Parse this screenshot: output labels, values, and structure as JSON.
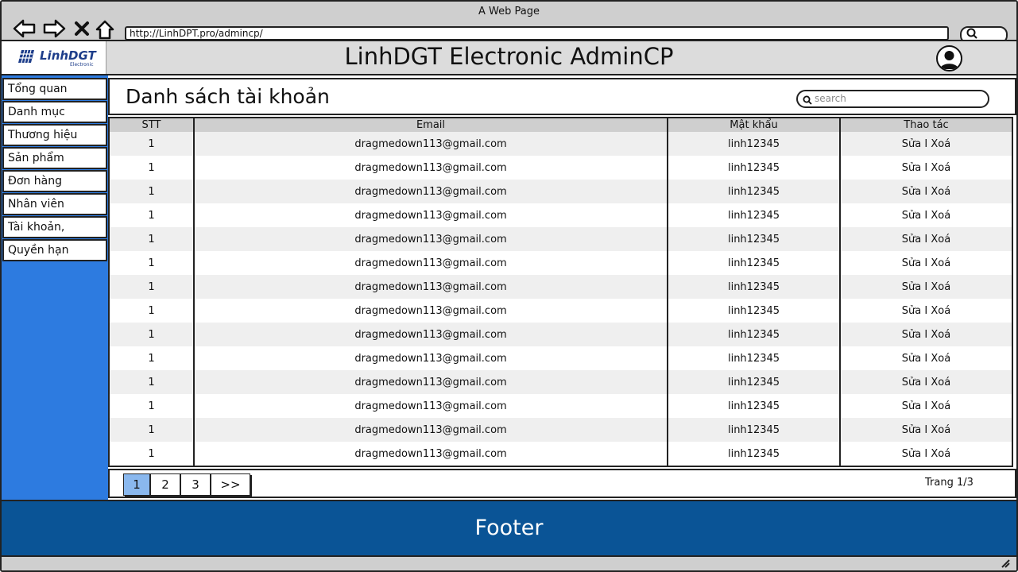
{
  "window": {
    "title": "A Web Page"
  },
  "browser": {
    "url": "http://LinhDPT.pro/admincp/",
    "back_icon": "back-arrow-icon",
    "forward_icon": "forward-arrow-icon",
    "close_icon": "close-icon",
    "home_icon": "home-icon",
    "search_icon": "search-icon"
  },
  "header": {
    "logo_text": "LinhDGT",
    "logo_sub": "Electronic",
    "title": "LinhDGT Electronic AdminCP",
    "avatar_icon": "user-avatar-icon"
  },
  "sidebar": {
    "items": [
      {
        "label": "Tổng quan"
      },
      {
        "label": "Danh mục"
      },
      {
        "label": "Thương hiệu"
      },
      {
        "label": "Sản phẩm"
      },
      {
        "label": "Đơn hàng"
      },
      {
        "label": "Nhân viên"
      },
      {
        "label": "Tài khoản,"
      },
      {
        "label": "Quyền hạn"
      }
    ]
  },
  "main": {
    "title": "Danh sách tài khoản",
    "search_placeholder": "search",
    "table": {
      "columns": [
        "STT",
        "Email",
        "Mật khẩu",
        "Thao tác"
      ],
      "rows": [
        [
          "1",
          "dragmedown113@gmail.com",
          "linh12345",
          "Sửa I Xoá"
        ],
        [
          "1",
          "dragmedown113@gmail.com",
          "linh12345",
          "Sửa I Xoá"
        ],
        [
          "1",
          "dragmedown113@gmail.com",
          "linh12345",
          "Sửa I Xoá"
        ],
        [
          "1",
          "dragmedown113@gmail.com",
          "linh12345",
          "Sửa I Xoá"
        ],
        [
          "1",
          "dragmedown113@gmail.com",
          "linh12345",
          "Sửa I Xoá"
        ],
        [
          "1",
          "dragmedown113@gmail.com",
          "linh12345",
          "Sửa I Xoá"
        ],
        [
          "1",
          "dragmedown113@gmail.com",
          "linh12345",
          "Sửa I Xoá"
        ],
        [
          "1",
          "dragmedown113@gmail.com",
          "linh12345",
          "Sửa I Xoá"
        ],
        [
          "1",
          "dragmedown113@gmail.com",
          "linh12345",
          "Sửa I Xoá"
        ],
        [
          "1",
          "dragmedown113@gmail.com",
          "linh12345",
          "Sửa I Xoá"
        ],
        [
          "1",
          "dragmedown113@gmail.com",
          "linh12345",
          "Sửa I Xoá"
        ],
        [
          "1",
          "dragmedown113@gmail.com",
          "linh12345",
          "Sửa I Xoá"
        ],
        [
          "1",
          "dragmedown113@gmail.com",
          "linh12345",
          "Sửa I Xoá"
        ],
        [
          "1",
          "dragmedown113@gmail.com",
          "linh12345",
          "Sửa I Xoá"
        ]
      ]
    },
    "pagination": {
      "pages": [
        "1",
        "2",
        "3",
        ">>"
      ],
      "active": "1",
      "info": "Trang 1/3"
    }
  },
  "footer": {
    "label": "Footer"
  },
  "colors": {
    "sidebar": "#2d7be0",
    "footer": "#0a5496",
    "active_page": "#8ab8ee",
    "chrome": "#cfcfcf"
  }
}
